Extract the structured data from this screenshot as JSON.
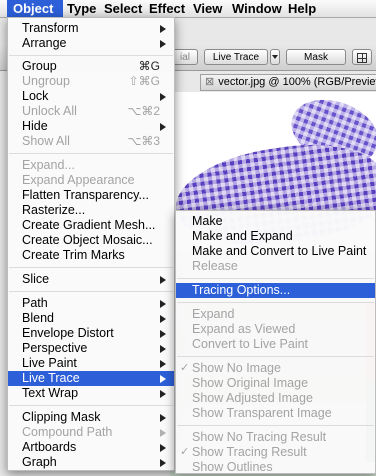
{
  "menubar": {
    "items": [
      "Object",
      "Type",
      "Select",
      "Effect",
      "View",
      "Window",
      "Help"
    ]
  },
  "controlbar": {
    "live_trace_button": "Live Trace",
    "mask_button": "Mask",
    "partial_label": "ial"
  },
  "document": {
    "tab_title": "vector.jpg @ 100% (RGB/Preview)"
  },
  "object_menu": {
    "items": [
      {
        "label": "Transform",
        "submenu": true
      },
      {
        "label": "Arrange",
        "submenu": true
      },
      {
        "label": "Group",
        "shortcut": "⌘G"
      },
      {
        "label": "Ungroup",
        "shortcut": "⇧⌘G",
        "disabled": true
      },
      {
        "label": "Lock",
        "submenu": true
      },
      {
        "label": "Unlock All",
        "shortcut": "⌥⌘2",
        "disabled": true
      },
      {
        "label": "Hide",
        "submenu": true
      },
      {
        "label": "Show All",
        "shortcut": "⌥⌘3",
        "disabled": true
      },
      {
        "label": "Expand...",
        "disabled": true
      },
      {
        "label": "Expand Appearance",
        "disabled": true
      },
      {
        "label": "Flatten Transparency..."
      },
      {
        "label": "Rasterize..."
      },
      {
        "label": "Create Gradient Mesh..."
      },
      {
        "label": "Create Object Mosaic..."
      },
      {
        "label": "Create Trim Marks"
      },
      {
        "label": "Slice",
        "submenu": true
      },
      {
        "label": "Path",
        "submenu": true
      },
      {
        "label": "Blend",
        "submenu": true
      },
      {
        "label": "Envelope Distort",
        "submenu": true
      },
      {
        "label": "Perspective",
        "submenu": true
      },
      {
        "label": "Live Paint",
        "submenu": true
      },
      {
        "label": "Live Trace",
        "submenu": true,
        "highlighted": true
      },
      {
        "label": "Text Wrap",
        "submenu": true
      },
      {
        "label": "Clipping Mask",
        "submenu": true
      },
      {
        "label": "Compound Path",
        "submenu": true,
        "disabled": true
      },
      {
        "label": "Artboards",
        "submenu": true
      },
      {
        "label": "Graph",
        "submenu": true
      }
    ]
  },
  "live_trace_menu": {
    "items": [
      {
        "label": "Make"
      },
      {
        "label": "Make and Expand"
      },
      {
        "label": "Make and Convert to Live Paint"
      },
      {
        "label": "Release",
        "disabled": true
      },
      {
        "label": "Tracing Options...",
        "highlighted": true
      },
      {
        "label": "Expand",
        "disabled": true
      },
      {
        "label": "Expand as Viewed",
        "disabled": true
      },
      {
        "label": "Convert to Live Paint",
        "disabled": true
      },
      {
        "label": "Show No Image",
        "disabled": true,
        "checked": true
      },
      {
        "label": "Show Original Image",
        "disabled": true
      },
      {
        "label": "Show Adjusted Image",
        "disabled": true
      },
      {
        "label": "Show Transparent Image",
        "disabled": true
      },
      {
        "label": "Show No Tracing Result",
        "disabled": true
      },
      {
        "label": "Show Tracing Result",
        "disabled": true,
        "checked": true
      },
      {
        "label": "Show Outlines",
        "disabled": true
      }
    ],
    "check_glyph": "✓"
  },
  "colors": {
    "highlight": "#2c5fd8",
    "disabled_text": "#a3a3a3"
  }
}
